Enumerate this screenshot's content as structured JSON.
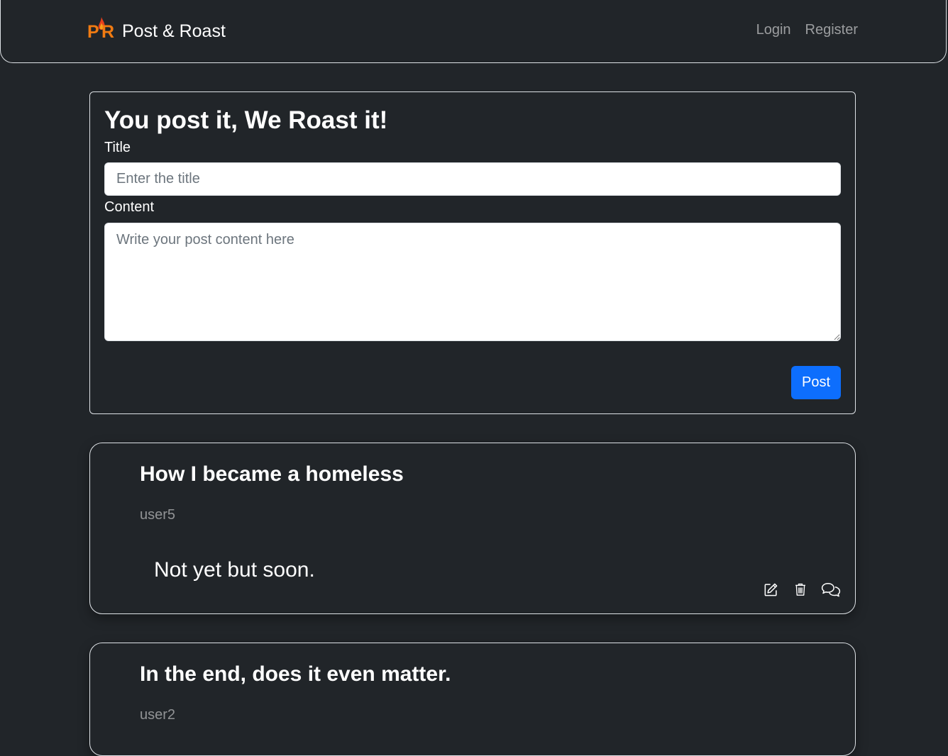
{
  "navbar": {
    "brand_logo_letters": "PR",
    "brand_logo_p": "P",
    "brand_logo_r": "R",
    "brand_name": "Post & Roast",
    "links": [
      "Login",
      "Register"
    ]
  },
  "form": {
    "heading": "You post it, We Roast it!",
    "title_label": "Title",
    "title_placeholder": "Enter the title",
    "title_value": "",
    "content_label": "Content",
    "content_placeholder": "Write your post content here",
    "content_value": "",
    "submit_label": "Post"
  },
  "posts": [
    {
      "title": "How I became a homeless",
      "author": "user5",
      "body": "Not yet but soon.",
      "actions": [
        "edit-icon",
        "trash-icon",
        "comments-icon"
      ]
    },
    {
      "title": "In the end, does it even matter.",
      "author": "user2"
    }
  ],
  "colors": {
    "background": "#212529",
    "border": "#dee2e6",
    "primary": "#0d6efd",
    "logo_orange": "#f07b12",
    "logo_flame": "#e8401c",
    "muted_text": "rgba(255,255,255,0.5)"
  }
}
